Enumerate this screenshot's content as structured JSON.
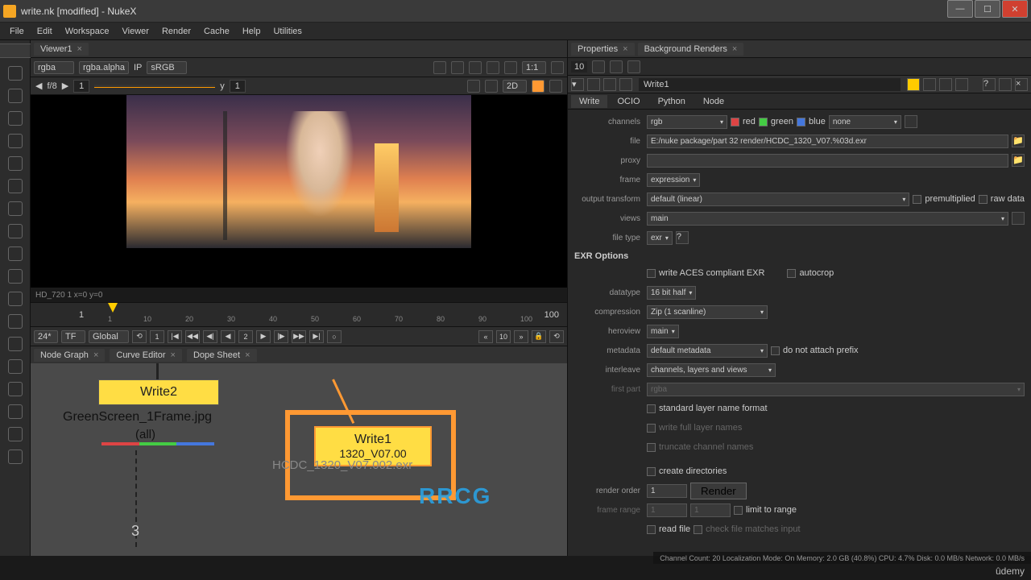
{
  "window": {
    "title": "write.nk [modified] - NukeX"
  },
  "menu": [
    "File",
    "Edit",
    "Workspace",
    "Viewer",
    "Render",
    "Cache",
    "Help",
    "Utilities"
  ],
  "viewer": {
    "tab": "Viewer1",
    "chA": "rgba",
    "chB": "rgba.alpha",
    "ip": "IP",
    "cs": "sRGB",
    "ratio": "1:1",
    "fstop": "f/8",
    "frame": "1",
    "yframe": "1",
    "mode2d": "2D",
    "status": "HD_720 1 x=0 y=0",
    "ticks": [
      "1",
      "10",
      "20",
      "30",
      "40",
      "50",
      "60",
      "70",
      "80",
      "90",
      "100"
    ],
    "tl_start": "1",
    "tl_end": "100",
    "fps": "24*",
    "tf": "TF",
    "scope": "Global",
    "curframe": "1",
    "cur2": "2",
    "lowertabs": [
      {
        "l": "Node Graph"
      },
      {
        "l": "Curve Editor"
      },
      {
        "l": "Dope Sheet"
      }
    ]
  },
  "nodes": {
    "write2": {
      "name": "Write2",
      "file": "GreenScreen_1Frame.jpg",
      "scope": "(all)"
    },
    "write1": {
      "name": "Write1",
      "file": "HCDC_1320_V07.002.exr",
      "short": "1320_V07.00"
    },
    "num3": "3"
  },
  "props": {
    "tabs": [
      {
        "l": "Properties"
      },
      {
        "l": "Background Renders"
      }
    ],
    "count": "10",
    "nodeName": "Write1",
    "subtabs": [
      "Write",
      "OCIO",
      "Python",
      "Node"
    ],
    "channels": {
      "val": "rgb",
      "r": "red",
      "g": "green",
      "b": "blue",
      "none": "none"
    },
    "file": "E:/nuke package/part 32 render/HCDC_1320_V07.%03d.exr",
    "proxy": "",
    "frame": "expression",
    "outxform": "default (linear)",
    "premult": "premultiplied",
    "rawdata": "raw data",
    "views": "main",
    "filetype": "exr",
    "exr_title": "EXR Options",
    "aces": "write ACES compliant EXR",
    "autocrop": "autocrop",
    "datatype": "16 bit half",
    "compression": "Zip (1 scanline)",
    "heroview": "main",
    "metadata": "default metadata",
    "noprefix": "do not attach prefix",
    "interleave": "channels, layers and views",
    "firstpart": "first part",
    "firstpart_v": "rgba",
    "stdlayer": "standard layer name format",
    "fulllayer": "write full layer names",
    "trunc": "truncate channel names",
    "createdirs": "create directories",
    "renderorder_l": "render order",
    "renderorder": "1",
    "renderbtn": "Render",
    "framerange_l": "frame range",
    "framerange_a": "1",
    "framerange_b": "1",
    "limit": "limit to range",
    "readfile": "read file",
    "checkmatch": "check file matches input"
  },
  "status": "Channel Count: 20 Localization Mode: On Memory: 2.0 GB (40.8%) CPU: 4.7% Disk: 0.0 MB/s Network: 0.0 MB/s",
  "watermark": "RRCG",
  "udemy": "ûdemy"
}
